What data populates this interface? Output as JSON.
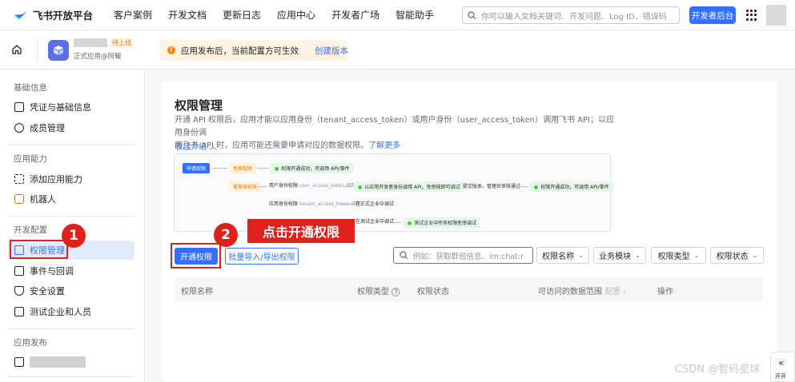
{
  "topbar": {
    "logo_text": "飞书开放平台",
    "nav": [
      "客户案例",
      "开发文档",
      "更新日志",
      "应用中心",
      "开发者广场",
      "智能助手"
    ],
    "search_placeholder": "你可以输入文档关键词、开发问题、Log ID、错误码",
    "dev_console_label": "开发者后台"
  },
  "appbar": {
    "app_badge": "待上线",
    "app_subtitle": "正式应用@阿鲅",
    "notice_text": "应用发布后，当前配置方可生效",
    "notice_link": "创建版本"
  },
  "sidebar": {
    "sections": [
      {
        "title": "基础信息",
        "items": [
          "凭证与基础信息",
          "成员管理"
        ]
      },
      {
        "title": "应用能力",
        "items": [
          "添加应用能力",
          "机器人"
        ]
      },
      {
        "title": "开发配置",
        "items": [
          "权限管理",
          "事件与回调",
          "安全设置",
          "测试企业和人员"
        ]
      },
      {
        "title": "应用发布",
        "items": []
      }
    ],
    "active_item": "权限管理"
  },
  "main": {
    "title": "权限管理",
    "description_1": "开通 API 权限后，应用才能以应用身份（tenant_access_token）或用户身份（user_access_token）调用飞书 API；以应用身份调",
    "description_2": "用飞书 API 时，应用可能还需要申请对应的数据权限。",
    "learn_more": "了解更多",
    "collapse_label": "收起介绍",
    "flow": {
      "apply": "申请权限",
      "free_review": "免审权限",
      "need_review": "需审核权限",
      "opened_ok": "权限开通成功，可调用 API/事件",
      "user_identity": "用户身份权限",
      "user_token": "user_access_token",
      "call": "调用",
      "dev_call": "以应用开发者身份调用 API，免审核即可调试",
      "submit": "提交版本，管理员审核通过",
      "app_identity": "应用身份权限",
      "tenant_token": "tenant_access_token",
      "test_in_prod": "在正式企业中调试",
      "test_in_test": "在测试企业中调试",
      "test_ent_note": "测试企业中所有权限免审调试"
    },
    "callouts": {
      "one": "1",
      "two": "2",
      "label": "点击开通权限"
    },
    "buttons": {
      "open": "开通权限",
      "batch": "批量导入/导出权限"
    },
    "filter_placeholder": "例如：获取群组信息、im:chat:r",
    "filters": [
      "权限名称",
      "业务模块",
      "权限类型",
      "权限状态"
    ],
    "table_headers": {
      "name": "权限名称",
      "type": "权限类型",
      "status": "权限状态",
      "scope": "可访问的数据范围",
      "config": "配置",
      "action": "操作"
    }
  },
  "overlay": {
    "watermark": "CSDN @智码星球",
    "corner_label": "开开"
  },
  "colors": {
    "accent": "#3370ff",
    "callout": "#e0211b",
    "notice": "#ff8800"
  }
}
